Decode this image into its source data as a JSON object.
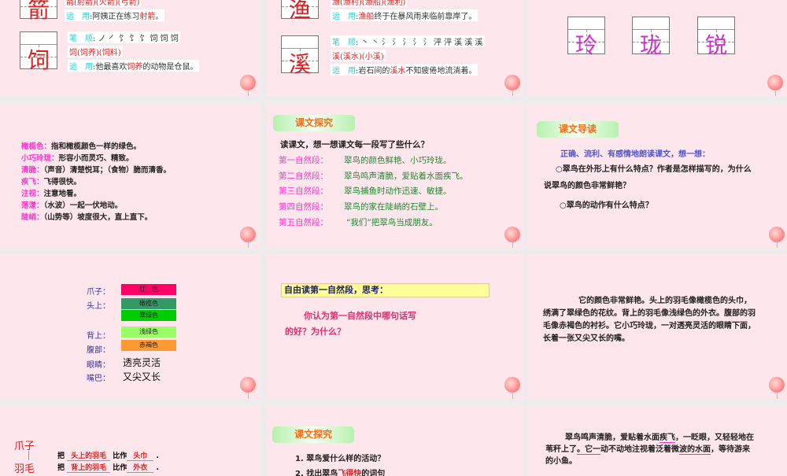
{
  "slides": [
    {
      "char1": "箭",
      "line1": "箭(射箭)(火箭)(弓箭)",
      "use1_label": "运　用",
      "use1": "阿姨正在练习",
      "use1_hl": "射箭",
      "char2": "饲",
      "order_label": "笔　顺",
      "order2": "ノ ㇒ 饣 饣 饣 饲 饲 饲",
      "words2": "饲(饲养)(饲料)",
      "use2_label": "运　用",
      "use2_pre": "他最喜欢",
      "use2_hl": "饲养",
      "use2_post": "的动物是仓鼠。"
    },
    {
      "char1": "渔",
      "line1": "渔(渔村)(渔船)(渔利)",
      "use1_label": "运　用",
      "use1_hl": "渔船",
      "use1": "终于在暴风雨来临前靠岸了。",
      "char2": "溪",
      "order_label": "笔　顺",
      "order2": "丶 丶 氵 氵 氵 氵 氵 泙 泙 溪 溪 溪",
      "words2": "溪(溪水)(小溪)",
      "use2_label": "运　用",
      "use2_pre": "岩石间的",
      "use2_hl": "溪水",
      "use2_post": "不知疲倦地流淌着。"
    },
    {
      "chars": [
        "玲",
        "珑",
        "锐"
      ]
    },
    {
      "defs": [
        {
          "t": "橄榄色：",
          "d": "指和橄榄颜色一样的绿色。"
        },
        {
          "t": "小巧玲珑：",
          "d": "形容小而灵巧、精致。"
        },
        {
          "t": "清脆：",
          "d": "（声音）清楚悦耳；（食物）脆而清香。"
        },
        {
          "t": "疾飞：",
          "d": "飞得很快。"
        },
        {
          "t": "注视：",
          "d": "注意地看。"
        },
        {
          "t": "荡漾：",
          "d": "（水波）一起一伏地动。"
        },
        {
          "t": "陡峭：",
          "d": "（山势等）坡度很大，直上直下。"
        }
      ]
    },
    {
      "button": "课文探究",
      "question": "读课文，想一想课文每一段写了些什么？",
      "rows": [
        {
          "l": "第一自然段：",
          "c": "翠鸟的颜色鲜艳、小巧玲珑。"
        },
        {
          "l": "第二自然段：",
          "c": "翠鸟鸣声清脆，爱贴着水面疾飞。"
        },
        {
          "l": "第三自然段：",
          "c": "翠鸟捕鱼时动作迅速、敏捷。"
        },
        {
          "l": "第四自然段：",
          "c": "翠鸟的家在陡峭的石壁上。"
        },
        {
          "l": "第五自然段：",
          "c": "“我们”把翠鸟当成朋友。"
        }
      ]
    },
    {
      "button": "课文导读",
      "intro": "正确、流利、有感情地朗读课文，想一想：",
      "q1a": "翠鸟在外形上有什么特点？作者是怎样描写的，为什么",
      "q1b": "说翠鸟的颜色非常鲜艳？",
      "q2": "翠鸟的动作有什么特点？"
    },
    {
      "labels": [
        "爪子：",
        "头上：",
        "背上：",
        "腹部：",
        "眼睛：",
        "嘴巴："
      ],
      "bars": [
        {
          "t": "红　色",
          "c": "#ff0066"
        },
        {
          "t": "橄榄色",
          "c": "#339966"
        },
        {
          "t": "翠绿色",
          "c": "#00cc00"
        },
        {
          "t": "浅绿色",
          "c": "#99ff66"
        },
        {
          "t": "赤褐色",
          "c": "#ff9933"
        }
      ],
      "eyes": "透亮灵活",
      "mouth": "又尖又长"
    },
    {
      "box": "自由读第一自然段，思考：",
      "q1": "你认为第一自然段中哪句话写",
      "q2": "的好？为什么？"
    },
    {
      "lines": [
        "它的颜色非常鲜艳。头上的羽毛像橄榄色的头巾，",
        "绣满了翠绿色的花纹。背上的羽毛像浅绿色的外衣。腹部的羽",
        "毛像赤褐色的衬衫。它小巧玲珑，一对透亮灵活的眼睛下面，",
        "长着一张又尖又长的嘴。"
      ]
    },
    {
      "w1": "爪子",
      "w2": "羽毛",
      "ba": "把",
      "bz": "比作",
      "r1a": "头上的羽毛",
      "r1b": "头巾",
      "r2a": "背上的羽毛",
      "r2b": "外衣",
      "dot": "."
    },
    {
      "button": "课文探究",
      "q1": "1. 翠鸟爱什么样的活动？",
      "q2a": "2. 找出翠鸟",
      "q2b": "飞得快",
      "q2c": "的词句"
    },
    {
      "l1a": "翠鸟鸣声清脆，爱贴着水面",
      "l1b": "疾飞",
      "l1c": "，一眨眼，又轻轻地在",
      "l2a": "苇秆上了",
      "l2b": "。它一",
      "l2c": "动不动地注视着泛着微",
      "l2d": "波的水面",
      "l2e": "，等待游来",
      "l3": "的小鱼。"
    }
  ]
}
